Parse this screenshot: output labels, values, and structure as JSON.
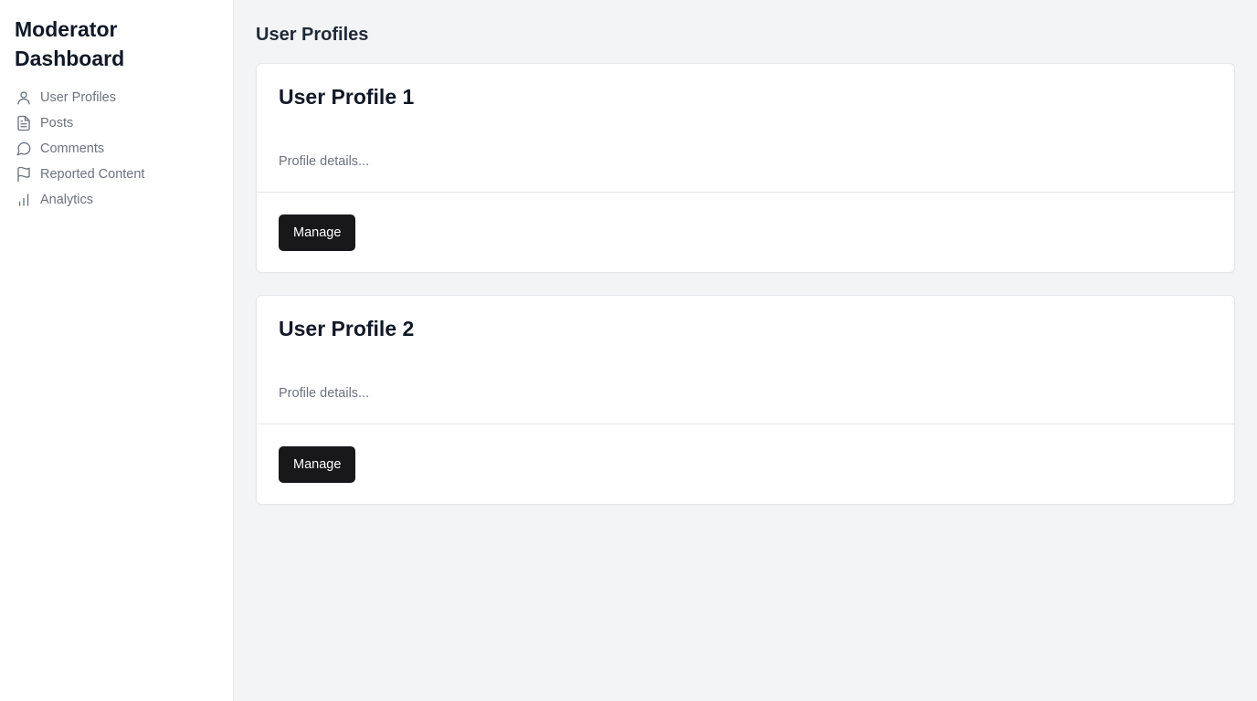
{
  "sidebar": {
    "title": "Moderator Dashboard",
    "items": [
      {
        "label": "User Profiles",
        "icon": "user-icon"
      },
      {
        "label": "Posts",
        "icon": "file-text-icon"
      },
      {
        "label": "Comments",
        "icon": "message-circle-icon"
      },
      {
        "label": "Reported Content",
        "icon": "flag-icon"
      },
      {
        "label": "Analytics",
        "icon": "bar-chart-icon"
      }
    ]
  },
  "main": {
    "title": "User Profiles",
    "cards": [
      {
        "title": "User Profile 1",
        "description": "Profile details...",
        "button_label": "Manage"
      },
      {
        "title": "User Profile 2",
        "description": "Profile details...",
        "button_label": "Manage"
      }
    ]
  },
  "colors": {
    "background": "#f3f4f6",
    "sidebar": "#ffffff",
    "button": "#18181b",
    "muted_text": "#6b7280"
  }
}
